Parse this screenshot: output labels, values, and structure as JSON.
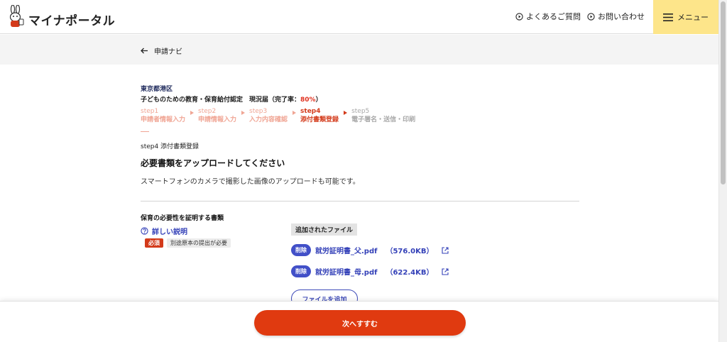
{
  "header": {
    "logo_text": "マイナポータル",
    "faq_label": "よくあるご質問",
    "contact_label": "お問い合わせ",
    "menu_label": "メニュー"
  },
  "breadcrumb": {
    "back_label": "申請ナビ"
  },
  "application": {
    "municipality": "東京都港区",
    "title_prefix": "子どものための教育・保育給付認定　現況届（完了率：",
    "completion_rate": "80%",
    "title_suffix": "）"
  },
  "steps": [
    {
      "num": "step1",
      "label": "申請者情報入力"
    },
    {
      "num": "step2",
      "label": "申請情報入力"
    },
    {
      "num": "step3",
      "label": "入力内容確認"
    },
    {
      "num": "step4",
      "label": "添付書類登録"
    },
    {
      "num": "step5",
      "label": "電子署名・送信・印刷"
    }
  ],
  "current_step": {
    "caption": "step4 添付書類登録",
    "heading": "必要書類をアップロードしてください",
    "description": "スマートフォンのカメラで撮影した画像のアップロードも可能です。"
  },
  "document": {
    "title": "保育の必要性を証明する書類",
    "detail_link": "詳しい説明",
    "required_tag": "必須",
    "note_tag": "別途原本の提出が必要",
    "added_files_label": "追加されたファイル",
    "delete_label": "削除",
    "files": [
      {
        "name": "就労証明書_父.pdf",
        "size": "（576.0KB）"
      },
      {
        "name": "就労証明書_母.pdf",
        "size": "（622.4KB）"
      }
    ],
    "add_file_label": "ファイルを追加"
  },
  "footer": {
    "next_label": "次へすすむ"
  },
  "colors": {
    "accent": "#e03a10",
    "link": "#3340b8",
    "menu_bg": "#fde58a"
  }
}
